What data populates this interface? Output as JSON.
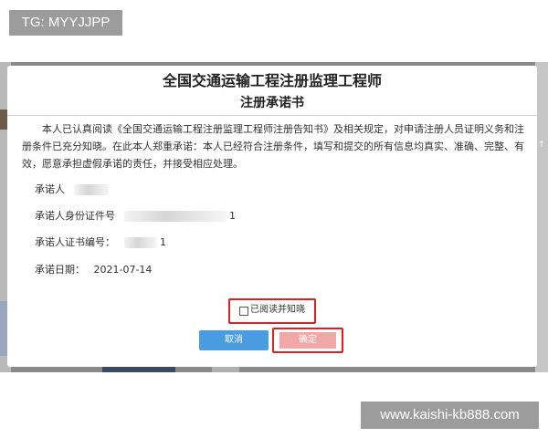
{
  "top_tag": "TG: MYYJJPP",
  "watermark": "www.kaishi-kb888.com",
  "dialog": {
    "title": "全国交通运输工程注册监理工程师",
    "subtitle": "注册承诺书",
    "declaration": "本人已认真阅读《全国交通运输工程注册监理工程师注册告知书》及相关规定，对申请注册人员证明义务和注册条件已充分知晓。在此本人郑重承诺：本人已经符合注册条件，填写和提交的所有信息均真实、准确、完整、有效，愿意承担虚假承诺的责任，并接受相应处理。",
    "fields": {
      "promisor_label": "承诺人",
      "id_label": "承诺人身份证件号",
      "id_tail": "1",
      "cert_label": "承诺人证书编号：",
      "cert_tail": "1",
      "date_label": "承诺日期：",
      "date_value": "2021-07-14"
    },
    "agree_label": "已阅读并知晓",
    "cancel_label": "取消",
    "confirm_label": "确定"
  },
  "colors": {
    "cancel_button": "#4a9ce0",
    "highlight_box": "#e02020",
    "backdrop": "#8a8a8a"
  }
}
